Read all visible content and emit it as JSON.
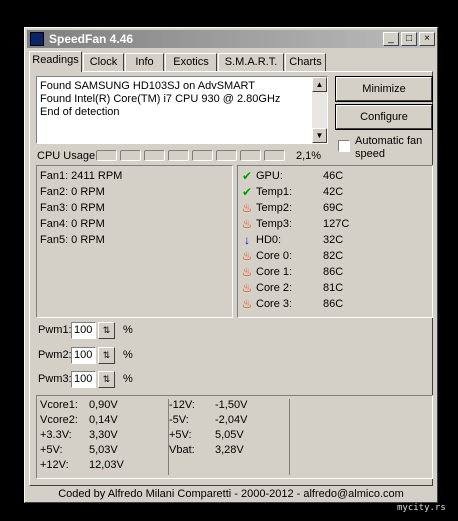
{
  "window": {
    "title": "SpeedFan 4.46"
  },
  "tabs": [
    "Readings",
    "Clock",
    "Info",
    "Exotics",
    "S.M.A.R.T.",
    "Charts"
  ],
  "log": [
    "Found SAMSUNG HD103SJ on AdvSMART",
    "Found Intel(R) Core(TM) i7 CPU 930 @ 2.80GHz",
    "End of detection"
  ],
  "buttons": {
    "minimize": "Minimize",
    "configure": "Configure"
  },
  "auto_fan": {
    "label": "Automatic fan speed",
    "checked": false
  },
  "cpu": {
    "label": "CPU Usage",
    "value": "2,1%"
  },
  "fans": [
    "Fan1: 2411 RPM",
    "Fan2: 0 RPM",
    "Fan3: 0 RPM",
    "Fan4: 0 RPM",
    "Fan5: 0 RPM"
  ],
  "temps": [
    {
      "name": "GPU:",
      "value": "46C",
      "icon": "check-icon"
    },
    {
      "name": "Temp1:",
      "value": "42C",
      "icon": "check-icon"
    },
    {
      "name": "Temp2:",
      "value": "69C",
      "icon": "flame-icon"
    },
    {
      "name": "Temp3:",
      "value": "127C",
      "icon": "flame-icon"
    },
    {
      "name": "HD0:",
      "value": "32C",
      "icon": "arrow-down-icon"
    },
    {
      "name": "Core 0:",
      "value": "82C",
      "icon": "flame-icon"
    },
    {
      "name": "Core 1:",
      "value": "86C",
      "icon": "flame-icon"
    },
    {
      "name": "Core 2:",
      "value": "81C",
      "icon": "flame-icon"
    },
    {
      "name": "Core 3:",
      "value": "86C",
      "icon": "flame-icon"
    }
  ],
  "pwm": [
    {
      "label": "Pwm1:",
      "value": "100",
      "unit": "%"
    },
    {
      "label": "Pwm2:",
      "value": "100",
      "unit": "%"
    },
    {
      "label": "Pwm3:",
      "value": "100",
      "unit": "%"
    }
  ],
  "voltages_left": [
    {
      "name": "Vcore1:",
      "value": "0,90V"
    },
    {
      "name": "Vcore2:",
      "value": "0,14V"
    },
    {
      "name": "+3.3V:",
      "value": "3,30V"
    },
    {
      "name": "+5V:",
      "value": "5,03V"
    },
    {
      "name": "+12V:",
      "value": "12,03V"
    }
  ],
  "voltages_right": [
    {
      "name": "-12V:",
      "value": "-1,50V"
    },
    {
      "name": "-5V:",
      "value": "-2,04V"
    },
    {
      "name": "+5V:",
      "value": "5,05V"
    },
    {
      "name": "Vbat:",
      "value": "3,28V"
    }
  ],
  "status": "Coded by Alfredo Milani Comparetti - 2000-2012 - alfredo@almico.com",
  "watermark": "mycity.rs",
  "colors": {
    "check": "#00a000",
    "flame": "#e04000",
    "arrow": "#0000cc",
    "titlebar": "#808080"
  }
}
